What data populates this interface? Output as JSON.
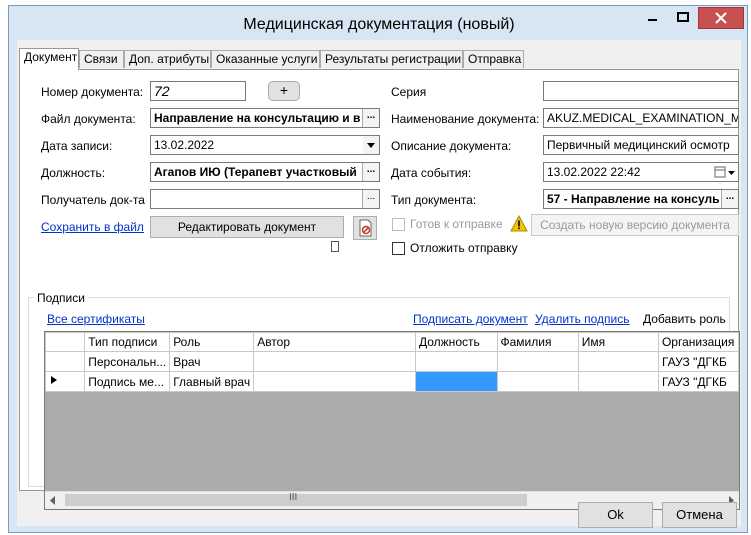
{
  "window": {
    "title": "Медицинская документация (новый)"
  },
  "tabs": [
    "Документ",
    "Связи",
    "Доп. атрибуты",
    "Оказанные услуги",
    "Результаты регистрации",
    "Отправка"
  ],
  "form": {
    "doc_number_label": "Номер документа:",
    "doc_number_value": "72",
    "doc_number_add": "+",
    "doc_file_label": "Файл документа:",
    "doc_file_value": "Направление на консультацию и в",
    "record_date_label": "Дата записи:",
    "record_date_value": "13.02.2022",
    "position_label": "Должность:",
    "position_value": "Агапов ИЮ (Терапевт участковый",
    "recipient_label": "Получатель док-та",
    "recipient_value": "",
    "save_file_link": "Сохранить в файл",
    "edit_doc_button": "Редактировать документ",
    "series_label": "Серия",
    "series_value": "",
    "doc_name_label": "Наименование документа:",
    "doc_name_value": "AKUZ.MEDICAL_EXAMINATION_MAII",
    "doc_desc_label": "Описание документа:",
    "doc_desc_value": "Первичный медицинский осмотр",
    "event_date_label": "Дата события:",
    "event_date_value": "13.02.2022 22:42",
    "doc_type_label": "Тип документа:",
    "doc_type_value": "57 - Направление на консуль",
    "ready_label": "Готов к отправке",
    "new_version_button": "Создать новую версию документа",
    "postpone_label": "Отложить отправку"
  },
  "signatures": {
    "group_label": "Подписи",
    "all_certs_link": "Все сертификаты",
    "sign_link": "Подписать документ",
    "delete_link": "Удалить подпись",
    "add_role_label": "Добавить роль",
    "columns": [
      "Тип подписи",
      "Роль",
      "Автор",
      "Должность",
      "Фамилия",
      "Имя",
      "Организация"
    ],
    "rows": [
      {
        "type": "Персональн...",
        "role": "Врач",
        "author": "",
        "position": "",
        "surname": "",
        "name": "",
        "org": "ГАУЗ \"ДГКБ"
      },
      {
        "type": "Подпись ме...",
        "role": "Главный врач",
        "author": "",
        "position": "",
        "surname": "",
        "name": "",
        "org": "ГАУЗ \"ДГКБ"
      }
    ],
    "scroll_grip": "III"
  },
  "footer": {
    "ok": "Ok",
    "cancel": "Отмена"
  },
  "colors": {
    "frame": "#d8e6f4",
    "close": "#c75050",
    "selected_cell": "#3399ff"
  }
}
